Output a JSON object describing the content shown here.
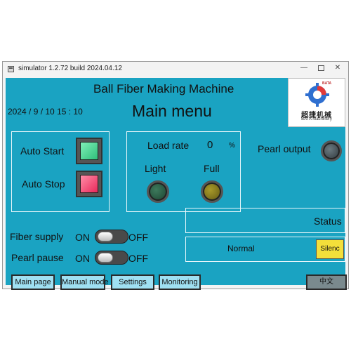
{
  "window": {
    "title": "simulator 1.2.72 build 2024.04.12",
    "min_glyph": "—",
    "close_glyph": "✕"
  },
  "header": {
    "machine_title": "Ball Fiber Making Machine",
    "date_time": "2024 /  9  / 10    15 : 10",
    "menu_title": "Main menu",
    "logo_text": "超捷机械",
    "logo_sub": "BATA Machinery",
    "logo_badge": "BATA"
  },
  "auto": {
    "start_label": "Auto Start",
    "stop_label": "Auto Stop"
  },
  "load": {
    "label": "Load rate",
    "value": "0",
    "unit": "%",
    "light_label": "Light",
    "full_label": "Full"
  },
  "pearl_output_label": "Pearl output",
  "fiber_supply": {
    "label": "Fiber supply",
    "on_label": "ON",
    "off_label": "OFF"
  },
  "pearl_pause": {
    "label": "Pearl pause",
    "on_label": "ON",
    "off_label": "OFF"
  },
  "status": {
    "label": "Status",
    "value": "Normal",
    "silence_label": "Silenc"
  },
  "nav": {
    "main_page": "Main page",
    "manual_mode": "Manual mode",
    "settings": "Settings",
    "monitoring": "Monitoring",
    "language": "中文"
  },
  "colors": {
    "screen_bg": "#1aa3c2",
    "start_green": "#2fbf7a",
    "stop_red": "#e8285a",
    "silence_yellow": "#f3df3a",
    "nav_button": "#9fe0f2"
  }
}
